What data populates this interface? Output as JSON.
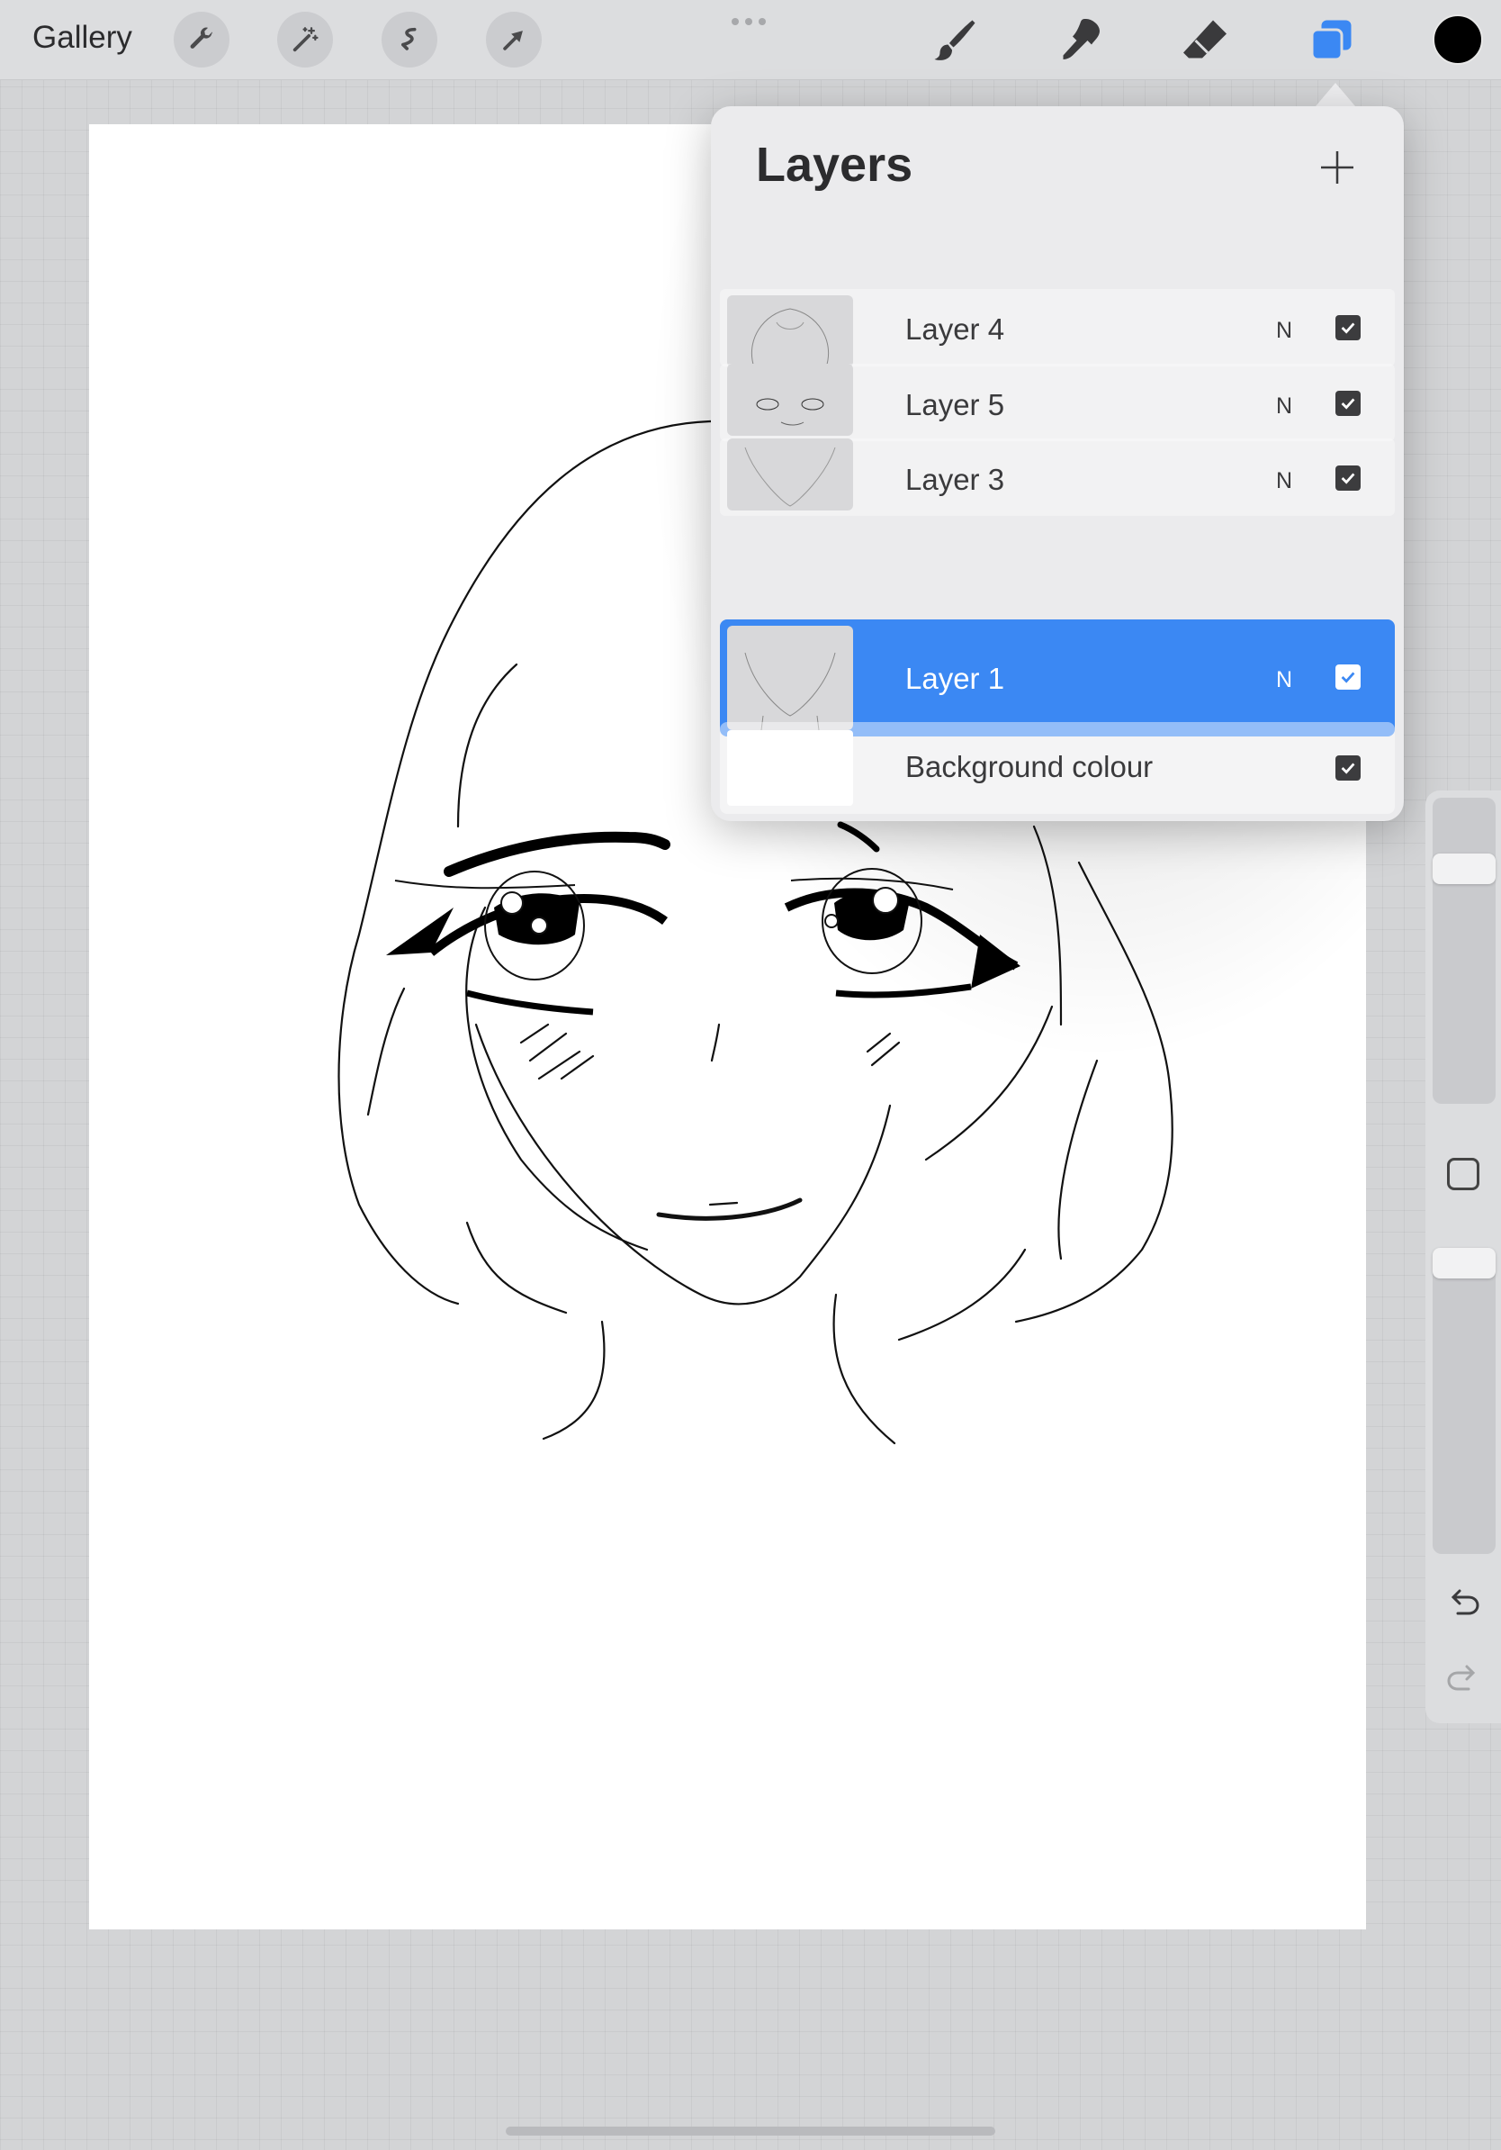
{
  "toolbar": {
    "gallery_label": "Gallery",
    "left_tools": [
      "wrench-icon",
      "magic-wand-icon",
      "selection-icon",
      "transform-arrow-icon"
    ],
    "right_tools": [
      "brush-icon",
      "smudge-icon",
      "eraser-icon",
      "layers-icon"
    ],
    "active_tool": "layers-icon",
    "accent_color": "#3b88f3",
    "current_color": "#000000"
  },
  "layers_panel": {
    "title": "Layers",
    "add_button": "plus-icon",
    "layers": [
      {
        "name": "Layer 4",
        "blend_mode": "N",
        "visible": true,
        "selected": false
      },
      {
        "name": "Layer 5",
        "blend_mode": "N",
        "visible": true,
        "selected": false
      },
      {
        "name": "Layer 3",
        "blend_mode": "N",
        "visible": true,
        "selected": false
      },
      {
        "name": "Layer 1",
        "blend_mode": "N",
        "visible": true,
        "selected": true
      }
    ],
    "background": {
      "label": "Background colour",
      "visible": true,
      "color": "#ffffff"
    }
  },
  "sidebar": {
    "controls": [
      "brush-size-slider",
      "modify-button",
      "opacity-slider",
      "undo-icon",
      "redo-icon"
    ]
  }
}
